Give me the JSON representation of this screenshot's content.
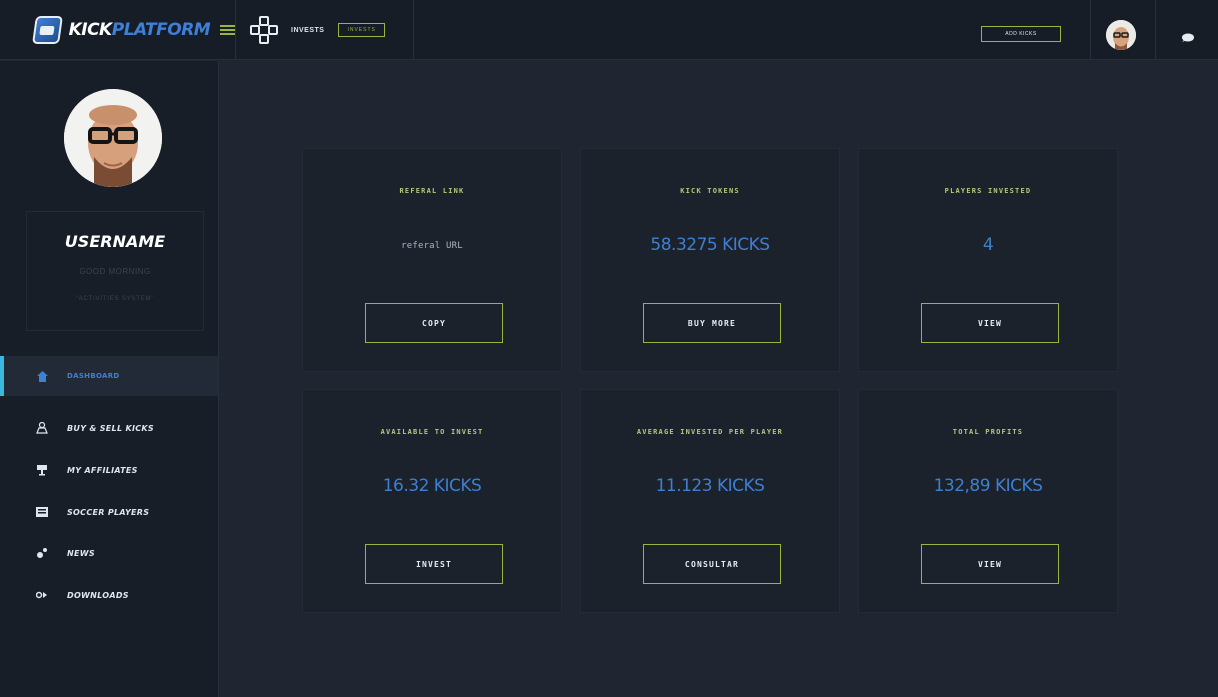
{
  "header": {
    "brand_part1": "KICK",
    "brand_part2": "PLATFORM",
    "invest_label": "INVESTS",
    "invest_badge": "INVESTS",
    "add_kicks_label": "ADD KICKS"
  },
  "sidebar": {
    "username": "USERNAME",
    "greeting": "GOOD MORNING",
    "status": "\"ACTIVITIES SYSTEM\"",
    "items": [
      {
        "label": "DASHBOARD",
        "icon": "home-icon",
        "active": true
      },
      {
        "label": "BUY & SELL KICKS",
        "icon": "exchange-icon",
        "active": false
      },
      {
        "label": "MY AFFILIATES",
        "icon": "affiliates-icon",
        "active": false
      },
      {
        "label": "SOCCER PLAYERS",
        "icon": "players-icon",
        "active": false
      },
      {
        "label": "NEWS",
        "icon": "news-icon",
        "active": false
      },
      {
        "label": "DOWNLOADS",
        "icon": "downloads-icon",
        "active": false
      }
    ]
  },
  "cards": [
    {
      "title": "REFERAL LINK",
      "value": "referal URL",
      "button": "COPY"
    },
    {
      "title": "KICK TOKENS",
      "value": "58.3275 KICKS",
      "button": "BUY MORE"
    },
    {
      "title": "PLAYERS INVESTED",
      "value": "4",
      "button": "VIEW"
    },
    {
      "title": "AVAILABLE TO INVEST",
      "value": "16.32 KICKS",
      "button": "INVEST"
    },
    {
      "title": "AVERAGE INVESTED PER PLAYER",
      "value": "11.123 KICKS",
      "button": "CONSULTAR"
    },
    {
      "title": "TOTAL PROFITS",
      "value": "132,89 KICKS",
      "button": "VIEW"
    }
  ],
  "colors": {
    "accent_green": "#9db33f",
    "accent_blue": "#3e7fd0",
    "active_marker": "#3ab8e0",
    "background": "#1f2631",
    "panel": "#1b222c"
  }
}
